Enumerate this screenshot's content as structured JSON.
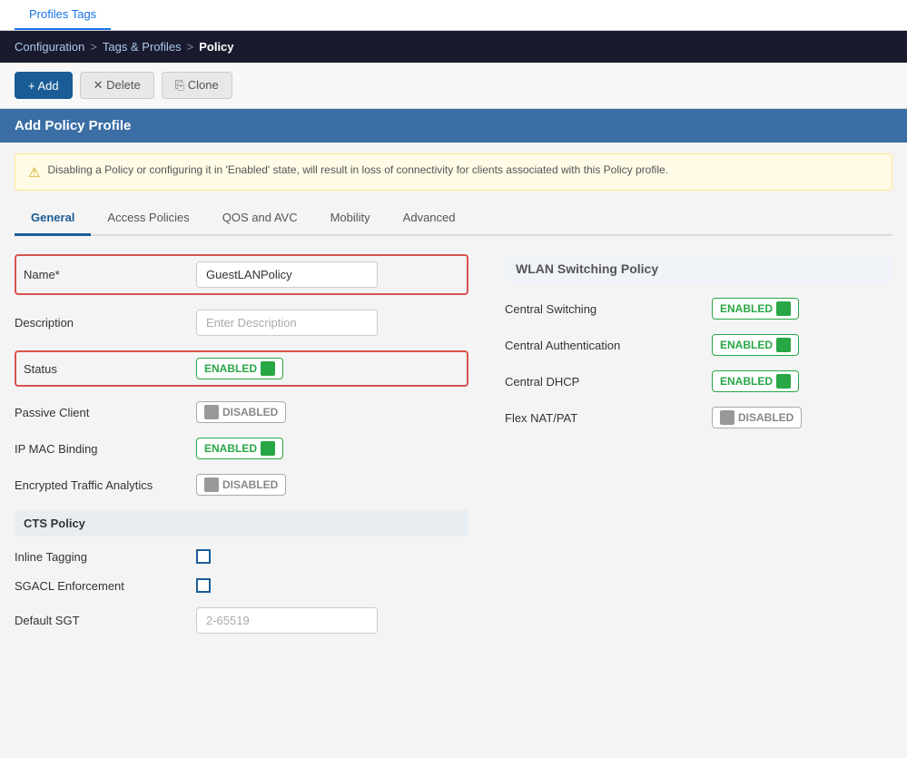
{
  "pageTab": {
    "tabs": [
      {
        "label": "Profiles Tags",
        "active": true
      }
    ]
  },
  "topNav": {
    "configuration": "Configuration",
    "tagsProfiles": "Tags & Profiles",
    "separator": ">",
    "current": "Policy"
  },
  "toolbar": {
    "addLabel": "+ Add",
    "deleteLabel": "✕ Delete",
    "cloneLabel": "⎘ Clone"
  },
  "panelHeader": "Add Policy Profile",
  "warning": {
    "icon": "⚠",
    "text": "Disabling a Policy or configuring it in 'Enabled' state, will result in loss of connectivity for clients associated with this Policy profile."
  },
  "contentTabs": [
    {
      "label": "General",
      "active": true
    },
    {
      "label": "Access Policies",
      "active": false
    },
    {
      "label": "QOS and AVC",
      "active": false
    },
    {
      "label": "Mobility",
      "active": false
    },
    {
      "label": "Advanced",
      "active": false
    }
  ],
  "form": {
    "nameLabel": "Name*",
    "nameValue": "GuestLANPolicy",
    "descriptionLabel": "Description",
    "descriptionPlaceholder": "Enter Description",
    "statusLabel": "Status",
    "statusEnabled": "ENABLED",
    "passiveClientLabel": "Passive Client",
    "passiveClientState": "DISABLED",
    "ipMacBindingLabel": "IP MAC Binding",
    "ipMacBindingState": "ENABLED",
    "encryptedTrafficLabel": "Encrypted Traffic Analytics",
    "encryptedTrafficState": "DISABLED",
    "ctsSectionLabel": "CTS Policy",
    "inlineTaggingLabel": "Inline Tagging",
    "sgaclEnforcementLabel": "SGACL Enforcement",
    "defaultSgtLabel": "Default SGT",
    "defaultSgtPlaceholder": "2-65519"
  },
  "wlanSection": {
    "header": "WLAN Switching Policy",
    "centralSwitchingLabel": "Central Switching",
    "centralSwitchingState": "ENABLED",
    "centralAuthLabel": "Central Authentication",
    "centralAuthState": "ENABLED",
    "centralDhcpLabel": "Central DHCP",
    "centralDhcpState": "ENABLED",
    "flexNatLabel": "Flex NAT/PAT",
    "flexNatState": "DISABLED"
  },
  "colors": {
    "enabledGreen": "#28a745",
    "disabledGray": "#999",
    "borderRed": "#d9534f",
    "headerBlue": "#3a6ea5",
    "navBlue": "#1a1a2e"
  }
}
